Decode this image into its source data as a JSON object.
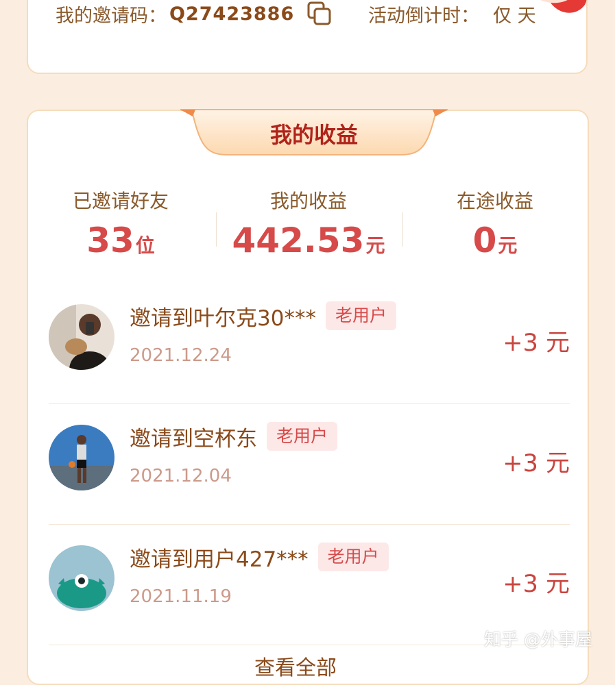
{
  "invite": {
    "label": "我的邀请码：",
    "code": "Q27423886",
    "countdown_label": "活动倒计时：",
    "countdown_value": "仅 天"
  },
  "earnings_card": {
    "title": "我的收益"
  },
  "stats": [
    {
      "label": "已邀请好友",
      "value": "33",
      "unit": "位"
    },
    {
      "label": "我的收益",
      "value": "442.53",
      "unit": "元"
    },
    {
      "label": "在途收益",
      "value": "0",
      "unit": "元"
    }
  ],
  "records": [
    {
      "title": "邀请到叶尔克30***",
      "tag": "老用户",
      "date": "2021.12.24",
      "amount": "+3 元"
    },
    {
      "title": "邀请到空杯东",
      "tag": "老用户",
      "date": "2021.12.04",
      "amount": "+3 元"
    },
    {
      "title": "邀请到用户427***",
      "tag": "老用户",
      "date": "2021.11.19",
      "amount": "+3 元"
    }
  ],
  "see_all_label": "查看全部",
  "watermark": "知乎 @外事屋",
  "colors": {
    "accent": "#d64a4a",
    "brown": "#8a4a1a",
    "background": "#fbeee0",
    "tag_bg": "#fde8e8"
  },
  "icons": {
    "copy": "copy-icon"
  }
}
